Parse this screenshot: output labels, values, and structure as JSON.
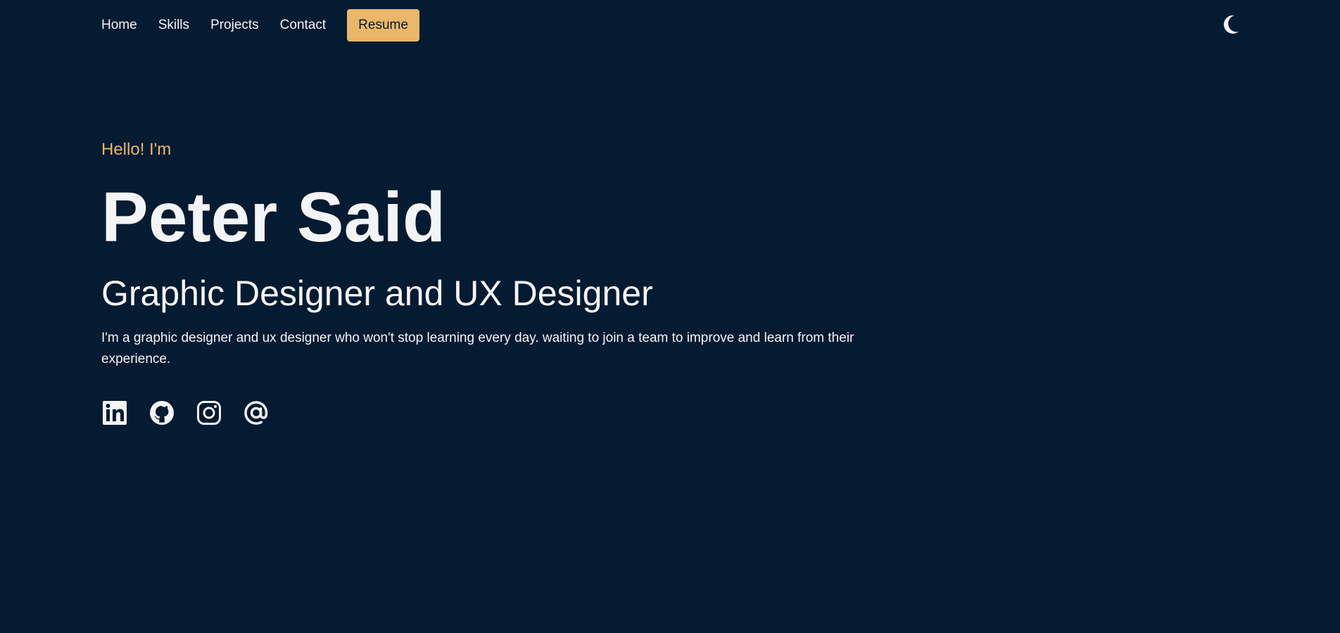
{
  "nav": {
    "items": [
      {
        "label": "Home"
      },
      {
        "label": "Skills"
      },
      {
        "label": "Projects"
      },
      {
        "label": "Contact"
      }
    ],
    "resume_label": "Resume",
    "theme_icon": "moon-icon"
  },
  "hero": {
    "greeting": "Hello! I'm",
    "name": "Peter Said",
    "role": "Graphic Designer and UX Designer",
    "bio": "I'm a graphic designer and ux designer who won't stop learning every day. waiting to join a team to improve and learn from their experience."
  },
  "socials": [
    {
      "icon": "linkedin-icon"
    },
    {
      "icon": "github-icon"
    },
    {
      "icon": "instagram-icon"
    },
    {
      "icon": "email-at-icon"
    }
  ],
  "colors": {
    "background": "#041b32",
    "accent": "#eab668",
    "text": "#f4f4f6"
  }
}
